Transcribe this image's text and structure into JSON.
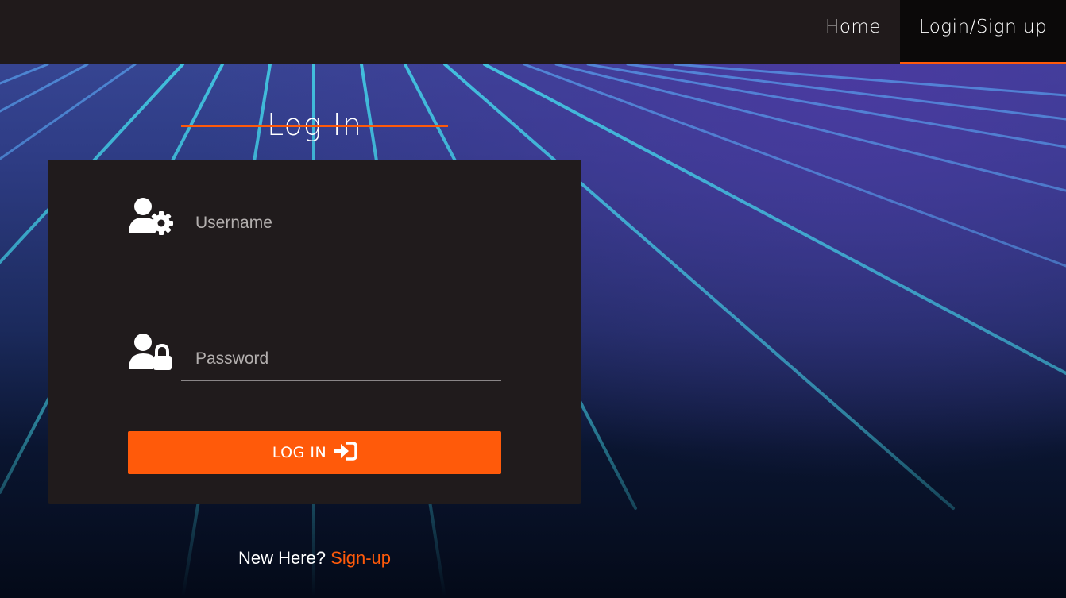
{
  "nav": {
    "items": [
      {
        "label": "Home",
        "active": false
      },
      {
        "label": "Login/Sign up",
        "active": true
      }
    ]
  },
  "login": {
    "title": "Log In",
    "username": {
      "placeholder": "Username",
      "value": "",
      "icon": "user-gear-icon"
    },
    "password": {
      "placeholder": "Password",
      "value": "",
      "icon": "user-lock-icon"
    },
    "submit_label": "LOG IN",
    "submit_icon": "sign-in-icon"
  },
  "signup": {
    "prompt": "New Here?",
    "link_label": "Sign-up"
  },
  "colors": {
    "accent": "#ff5a0a",
    "navbar": "#201a1b",
    "card": "#201b1c"
  }
}
